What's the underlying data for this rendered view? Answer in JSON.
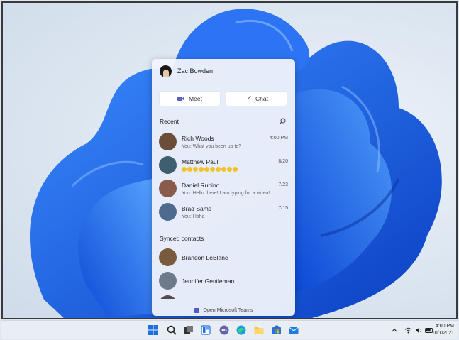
{
  "user": {
    "name": "Zac Bowden"
  },
  "actions": {
    "meet_label": "Meet",
    "chat_label": "Chat"
  },
  "recent": {
    "title": "Recent",
    "items": [
      {
        "name": "Rich Woods",
        "time": "4:00 PM",
        "message": "You: What you been up to?",
        "avatar_color": "#6b4e3a"
      },
      {
        "name": "Matthew Paul",
        "time": "8/20",
        "message": "",
        "emoji_count": 10,
        "avatar_color": "#3f5f6e"
      },
      {
        "name": "Daniel Rubino",
        "time": "7/23",
        "message": "You: Hello there! I am typing for a video!",
        "avatar_color": "#8a5b4a"
      },
      {
        "name": "Brad Sams",
        "time": "7/15",
        "message": "You: Haha",
        "avatar_color": "#4f6a8f"
      }
    ]
  },
  "synced": {
    "title": "Synced contacts",
    "items": [
      {
        "name": "Brandon LeBlanc",
        "avatar_color": "#7a5a3c"
      },
      {
        "name": "Jennifer Gentleman",
        "avatar_color": "#6e7a8a"
      }
    ]
  },
  "footer": {
    "label": "Open Microsoft Teams"
  },
  "clock": {
    "time": "4:00 PM",
    "date": "10/1/2021"
  },
  "colors": {
    "accent": "#5b5fc7",
    "wallpaper_blue": "#1a5fe0"
  }
}
